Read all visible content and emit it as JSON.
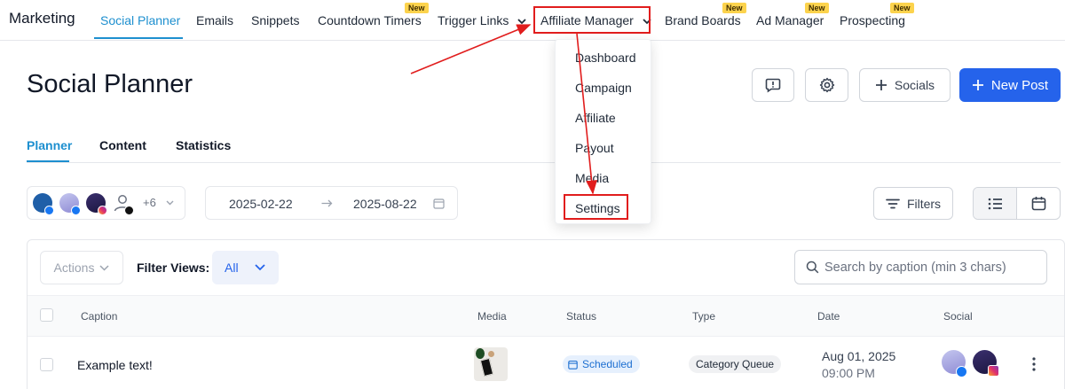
{
  "nav": {
    "brand": "Marketing",
    "items": [
      {
        "label": "Social Planner"
      },
      {
        "label": "Emails"
      },
      {
        "label": "Snippets"
      },
      {
        "label": "Countdown Timers"
      },
      {
        "label": "Trigger Links"
      },
      {
        "label": "Affiliate Manager"
      },
      {
        "label": "Brand Boards"
      },
      {
        "label": "Ad Manager"
      },
      {
        "label": "Prospecting"
      }
    ],
    "new_badge": "New"
  },
  "dropdown": {
    "items": [
      "Dashboard",
      "Campaign",
      "Affiliate",
      "Payout",
      "Media",
      "Settings"
    ]
  },
  "header": {
    "title": "Social Planner",
    "socials_label": "Socials",
    "new_post_label": "New Post"
  },
  "tabs": [
    "Planner",
    "Content",
    "Statistics"
  ],
  "toolbar": {
    "accounts_more": "+6",
    "date_start": "2025-02-22",
    "date_end": "2025-08-22",
    "filters_label": "Filters"
  },
  "table_controls": {
    "actions_label": "Actions",
    "filter_views_label": "Filter Views:",
    "filter_views_value": "All",
    "search_placeholder": "Search by caption (min 3 chars)"
  },
  "table": {
    "columns": [
      "Caption",
      "Media",
      "Status",
      "Type",
      "Date",
      "Social"
    ],
    "rows": [
      {
        "caption": "Example text!",
        "status": "Scheduled",
        "type": "Category Queue",
        "date": "Aug 01, 2025",
        "time": "09:00 PM"
      }
    ]
  },
  "colors": {
    "accent": "#1d8fcf",
    "primary": "#2563eb",
    "annotation_red": "#e11d1d",
    "badge_yellow": "#fcd34d"
  }
}
